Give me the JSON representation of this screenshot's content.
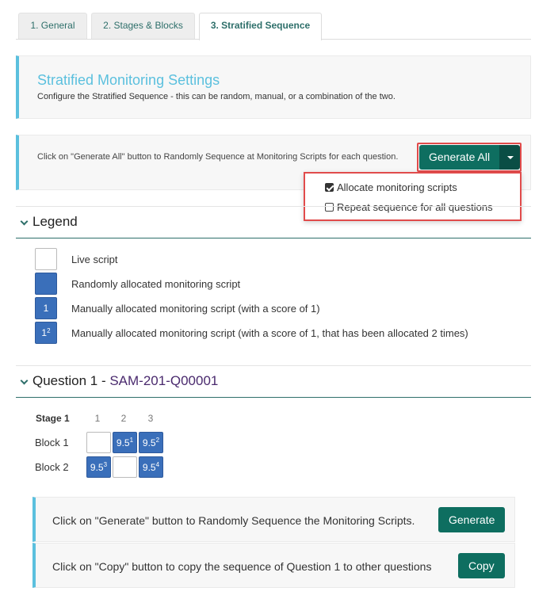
{
  "tabs": [
    {
      "label": "1. General"
    },
    {
      "label": "2. Stages & Blocks"
    },
    {
      "label": "3. Stratified Sequence"
    }
  ],
  "settings": {
    "title": "Stratified Monitoring Settings",
    "description": "Configure the Stratified Sequence - this can be random, manual, or a combination of the two."
  },
  "generate_all": {
    "text": "Click on \"Generate All\" button to Randomly Sequence at Monitoring Scripts for each question.",
    "button_label": "Generate All",
    "dropdown": [
      {
        "label": "Allocate monitoring scripts",
        "checked": true
      },
      {
        "label": "Repeat sequence for all questions",
        "checked": false
      }
    ]
  },
  "legend": {
    "title": "Legend",
    "items": [
      {
        "type": "live",
        "box": "",
        "sup": "",
        "label": "Live script"
      },
      {
        "type": "blue",
        "box": "",
        "sup": "",
        "label": "Randomly allocated monitoring script"
      },
      {
        "type": "blue",
        "box": "1",
        "sup": "",
        "label": "Manually allocated monitoring script (with a score of 1)"
      },
      {
        "type": "blue",
        "box": "1",
        "sup": "2",
        "label": "Manually allocated monitoring script (with a score of 1, that has been allocated 2 times)"
      }
    ]
  },
  "question": {
    "title": "Question 1 - ",
    "code": "SAM-201-Q00001",
    "stage_label": "Stage 1",
    "columns": [
      "1",
      "2",
      "3"
    ],
    "blocks": [
      {
        "label": "Block 1",
        "cells": [
          {
            "type": "live",
            "value": "",
            "sup": ""
          },
          {
            "type": "blue",
            "value": "9.5",
            "sup": "1"
          },
          {
            "type": "blue",
            "value": "9.5",
            "sup": "2"
          }
        ]
      },
      {
        "label": "Block 2",
        "cells": [
          {
            "type": "blue",
            "value": "9.5",
            "sup": "3"
          },
          {
            "type": "live",
            "value": "",
            "sup": ""
          },
          {
            "type": "blue",
            "value": "9.5",
            "sup": "4"
          }
        ]
      }
    ]
  },
  "actions": [
    {
      "text": "Click on \"Generate\" button to Randomly Sequence the Monitoring Scripts.",
      "button_label": "Generate"
    },
    {
      "text": "Click on \"Copy\" button to copy the sequence of Question 1 to other questions",
      "button_label": "Copy"
    }
  ],
  "colors": {
    "accent_teal": "#0e6e60",
    "info_blue": "#5bc0de",
    "cell_blue": "#3a6fba",
    "highlight_red": "#e14b4b",
    "code_purple": "#4a2a6e"
  }
}
